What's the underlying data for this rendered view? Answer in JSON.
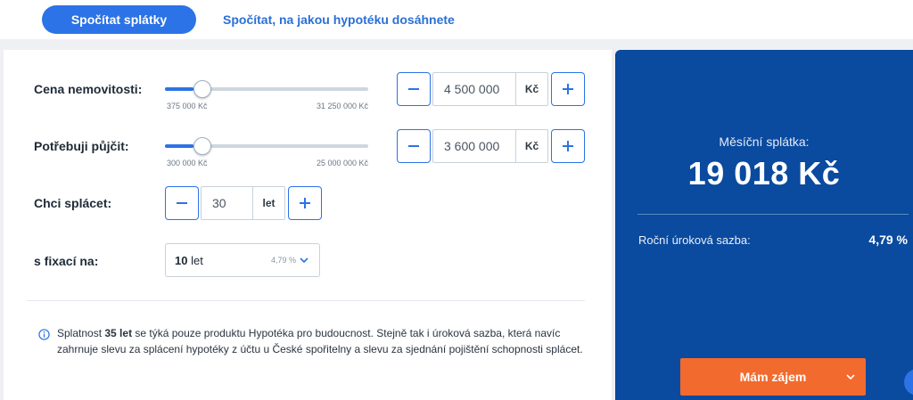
{
  "tabs": {
    "active": "Spočítat splátky",
    "other": "Spočítat, na jakou hypotéku dosáhnete"
  },
  "property_price": {
    "label": "Cena nemovitosti:",
    "slider_min": "375 000 Kč",
    "slider_max": "31 250 000 Kč",
    "slider_fraction": 0.14,
    "value": "4 500 000",
    "unit": "Kč"
  },
  "loan_amount": {
    "label": "Potřebuji půjčit:",
    "slider_min": "300 000 Kč",
    "slider_max": "25 000 000 Kč",
    "slider_fraction": 0.14,
    "value": "3 600 000",
    "unit": "Kč"
  },
  "term": {
    "label": "Chci splácet:",
    "value": "30",
    "unit": "let"
  },
  "fixation": {
    "label": "s fixací na:",
    "value_bold": "10",
    "value_unit": "let",
    "rate": "4,79 %"
  },
  "info": {
    "text_before": "Splatnost ",
    "text_bold": "35 let",
    "text_after": " se týká pouze produktu Hypotéka pro budoucnost. Stejně tak i úroková sazba, která navíc zahrnuje slevu za splácení hypotéky z účtu u České spořitelny a slevu za sjednání pojištění schopnosti splácet."
  },
  "result": {
    "monthly_label": "Měsíční splátka:",
    "monthly_amount": "19 018 Kč",
    "rate_label": "Roční úroková sazba:",
    "rate_value": "4,79 %",
    "cta_label": "Mám zájem"
  },
  "colors": {
    "accent": "#2b73e6",
    "panel": "#0a4a9f",
    "cta": "#f26a2e"
  },
  "icons": {
    "minus": "minus-icon",
    "plus": "plus-icon",
    "chevron": "chevron-down-icon",
    "info": "info-icon"
  }
}
